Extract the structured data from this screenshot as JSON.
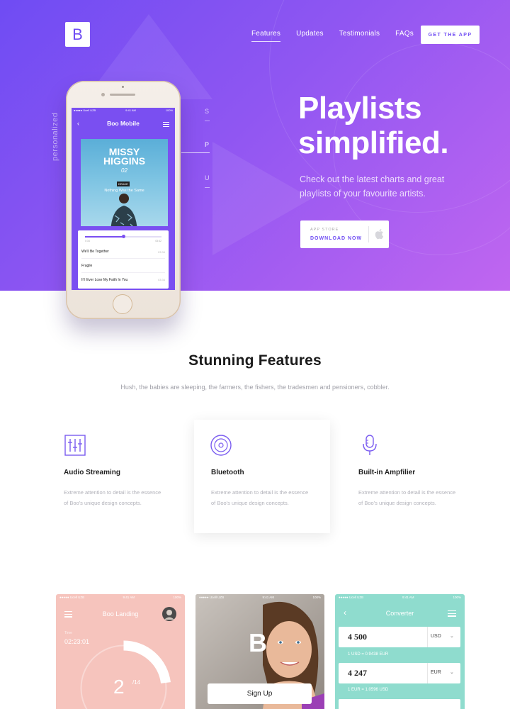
{
  "brand": {
    "logo_letter": "B"
  },
  "nav": {
    "items": [
      {
        "label": "Features",
        "active": true
      },
      {
        "label": "Updates"
      },
      {
        "label": "Testimonials"
      },
      {
        "label": "FAQs"
      }
    ],
    "cta": "GET THE APP"
  },
  "hero": {
    "side_label": "personalized",
    "pager": [
      "S",
      "P",
      "U"
    ],
    "title_line1": "Playlists",
    "title_line2": "simplified.",
    "subtitle": "Check out the latest charts and great playlists of your favourite artists.",
    "store_small": "APP STORE",
    "store_big": "DOWNLOAD NOW",
    "colors": {
      "gradient_start": "#6f4cf3",
      "gradient_end": "#c066f0"
    }
  },
  "phone": {
    "status_left": "●●●●● Ucell UZB",
    "status_time": "9:41 AM",
    "status_right": "100%",
    "title": "Boo Mobile",
    "album_artist_line1": "MISSY",
    "album_artist_line2": "HIGGINS",
    "album_number": "02",
    "album_tag": "DRAKE",
    "album_song": "Nothing Was the Same",
    "progress_fraction": 0.5,
    "time_start": "0:34",
    "time_end": "03:42",
    "tracks": [
      {
        "title": "We'll Be Together",
        "duration": "03:34"
      },
      {
        "title": "Fragile",
        "duration": ""
      },
      {
        "title": "If I Ever Lose My Faith In You",
        "duration": "03:34"
      }
    ]
  },
  "features_section": {
    "title": "Stunning Features",
    "subtitle": "Hush, the babies are sleeping, the farmers, the fishers, the tradesmen and pensioners, cobbler.",
    "items": [
      {
        "icon": "equalizer-icon",
        "title": "Audio Streaming",
        "desc": "Extreme attention to detail is the essence of Boo's unique design concepts."
      },
      {
        "icon": "disc-icon",
        "title": "Bluetooth",
        "desc": "Extreme attention to detail is the essence of Boo's unique design concepts."
      },
      {
        "icon": "microphone-icon",
        "title": "Built-in Ampfilier",
        "desc": "Extreme attention to detail is the essence of Boo's unique design concepts."
      }
    ]
  },
  "screens": {
    "landing": {
      "status_left": "●●●●● Ucell UZB",
      "status_time": "9:41 AM",
      "status_right": "100%",
      "title": "Boo Landing",
      "time_label": "Time",
      "time_value": "02:23:01",
      "count": "2",
      "count_of": "/14",
      "color": "#f6c4bd"
    },
    "signup": {
      "status_left": "●●●●● Ucell UZB",
      "status_time": "9:41 AM",
      "status_right": "100%",
      "logo_letter": "B",
      "button": "Sign Up"
    },
    "converter": {
      "status_left": "●●●●● Ucell UZB",
      "status_time": "9:41 AM",
      "status_right": "100%",
      "title": "Converter",
      "rows": [
        {
          "amount": "4 500",
          "currency": "USD",
          "rate": "1 USD = 0.9438 EUR"
        },
        {
          "amount": "4 247",
          "currency": "EUR",
          "rate": "1 EUR = 1.0596 USD"
        }
      ],
      "color": "#8fdcce"
    }
  }
}
